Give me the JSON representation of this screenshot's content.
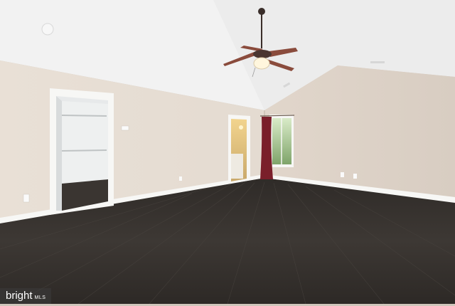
{
  "photo": {
    "subject": "empty-room-with-vaulted-ceiling",
    "colors": {
      "ceiling": "#f4f4f4",
      "wall": "#e6ddd3",
      "floor": "#3b3733",
      "baseboard": "#f7f7f5",
      "curtain": "#7a1f2a",
      "fan_blade": "#8a4b3c"
    }
  },
  "watermark": {
    "brand": "bright",
    "suffix": "MLS"
  }
}
